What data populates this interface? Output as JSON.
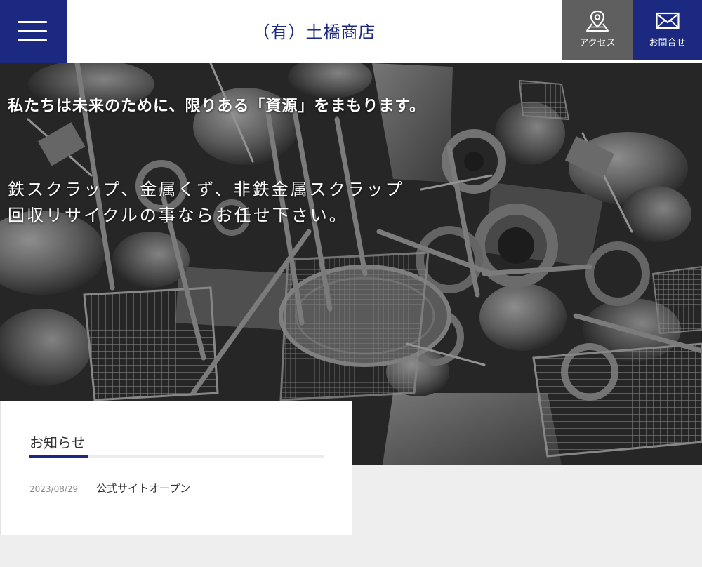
{
  "header": {
    "site_title": "（有）土橋商店",
    "access_label": "アクセス",
    "contact_label": "お問合せ"
  },
  "hero": {
    "tagline": "私たちは未来のために、限りある「資源」をまもります。",
    "line1": "鉄スクラップ、金属くず、非鉄金属スクラップ",
    "line2": "回収リサイクルの事ならお任せ下さい。"
  },
  "news": {
    "title": "お知らせ",
    "items": [
      {
        "date": "2023/08/29",
        "text": "公式サイトオープン"
      }
    ]
  },
  "colors": {
    "brand_navy": "#1b2a80",
    "access_gray": "#5f5f5f",
    "page_bg": "#eeeeee"
  },
  "icons": {
    "menu": "hamburger-icon",
    "access": "map-pin-icon",
    "contact": "envelope-icon"
  }
}
